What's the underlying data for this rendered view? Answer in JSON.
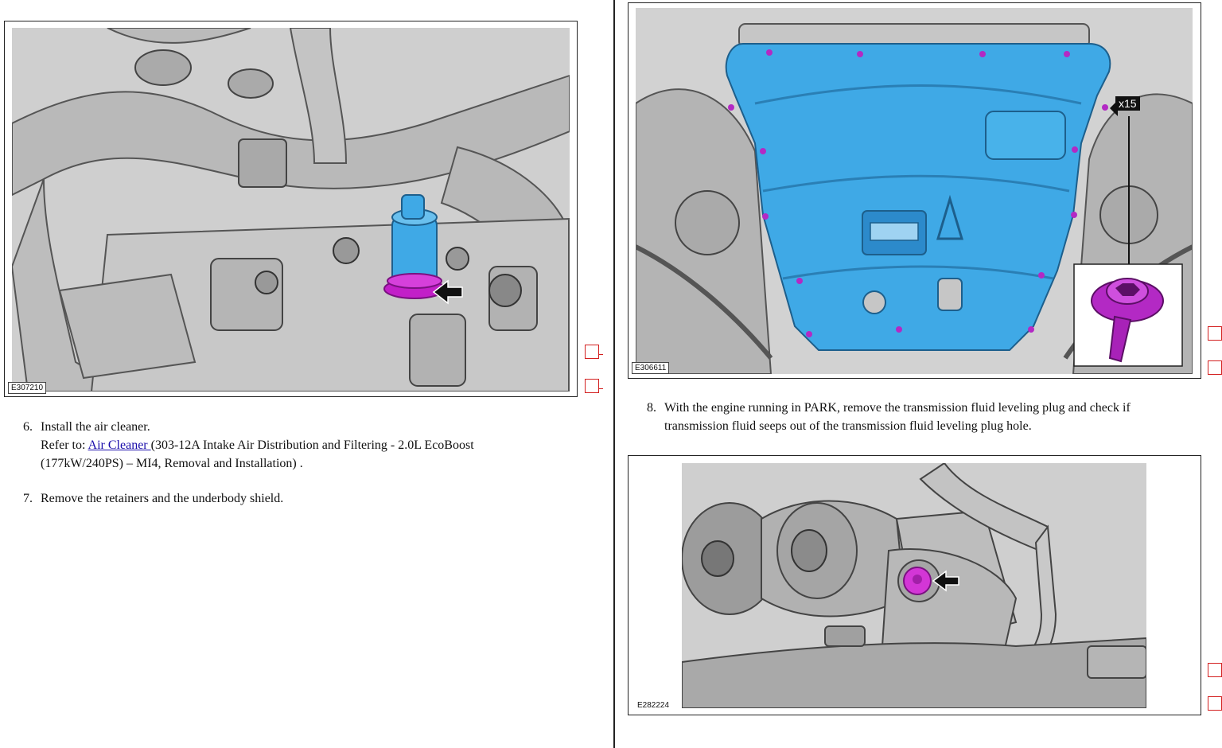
{
  "figures": {
    "fig1": {
      "id": "E307210"
    },
    "fig2": {
      "id": "E306611",
      "callout": "x15"
    },
    "fig3": {
      "id": "E282224"
    }
  },
  "steps": [
    {
      "number": "6.",
      "text": "Install the air cleaner.",
      "refer_prefix": "Refer to: ",
      "refer_link": "Air Cleaner ",
      "refer_rest_1": "(303-12A Intake Air Distribution and Filtering - 2.0L EcoBoost",
      "refer_rest_2": "(177kW/240PS) – MI4, Removal and Installation) ."
    },
    {
      "number": "7.",
      "text": "Remove the retainers and the underbody shield."
    },
    {
      "number": "8.",
      "line1": "With the engine running in PARK, remove the transmission fluid leveling plug and check if",
      "line2": "transmission fluid seeps out of the transmission fluid leveling plug hole."
    }
  ],
  "colors": {
    "highlight_blue": "#3fa9e6",
    "highlight_magenta": "#c21fc8",
    "checkbox_red": "#d32020",
    "link": "#1a0dab"
  }
}
